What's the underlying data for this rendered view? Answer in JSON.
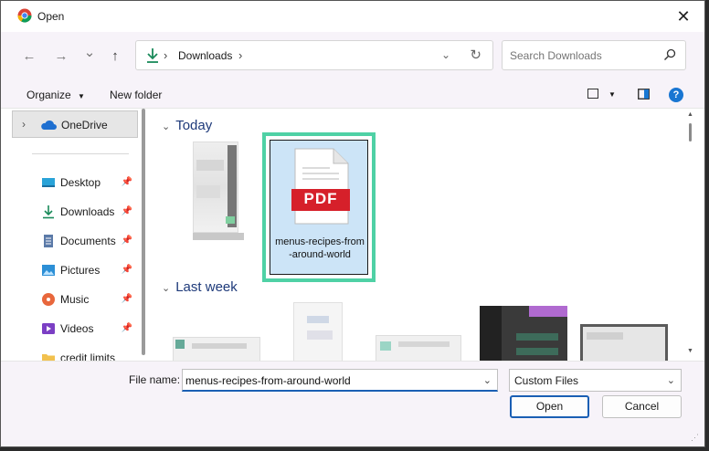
{
  "window": {
    "title": "Open",
    "close_label": "✕"
  },
  "nav": {
    "back_glyph": "←",
    "forward_glyph": "→",
    "recent_glyph": "⌄",
    "up_glyph": "↑",
    "breadcrumb": [
      "Downloads"
    ],
    "search_placeholder": "Search Downloads"
  },
  "toolbar": {
    "organize_label": "Organize",
    "new_folder_label": "New folder"
  },
  "sidebar": {
    "top_item": {
      "label": "OneDrive",
      "icon": "cloud-icon"
    },
    "items": [
      {
        "label": "Desktop",
        "icon": "desktop-icon",
        "pinned": true
      },
      {
        "label": "Downloads",
        "icon": "download-icon",
        "pinned": true
      },
      {
        "label": "Documents",
        "icon": "document-icon",
        "pinned": true
      },
      {
        "label": "Pictures",
        "icon": "pictures-icon",
        "pinned": true
      },
      {
        "label": "Music",
        "icon": "music-icon",
        "pinned": true
      },
      {
        "label": "Videos",
        "icon": "video-icon",
        "pinned": true
      },
      {
        "label": "credit limits",
        "icon": "folder-icon",
        "pinned": false
      }
    ]
  },
  "content": {
    "groups": [
      {
        "header": "Today"
      },
      {
        "header": "Last week"
      }
    ],
    "selected_file": {
      "name": "menus-recipes-from-around-world",
      "display_name": "menus-recipes-from-around-world",
      "badge": "PDF"
    }
  },
  "footer": {
    "file_name_label": "File name:",
    "file_name_value": "menus-recipes-from-around-world",
    "file_type_value": "Custom Files",
    "open_label": "Open",
    "cancel_label": "Cancel"
  },
  "colors": {
    "accent": "#1a5fb4",
    "selection_highlight": "#4fd1a5",
    "selection_fill": "#cce4f7",
    "pdf_red": "#d6202a",
    "group_header": "#1e3a7a"
  }
}
